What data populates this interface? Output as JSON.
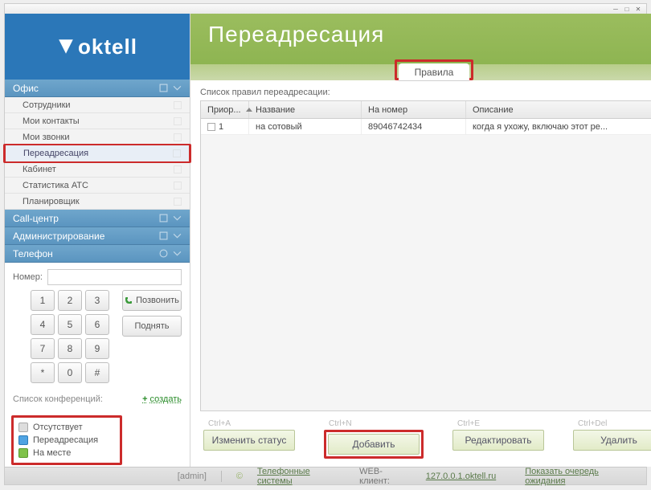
{
  "logo": "oktell",
  "sidebar": {
    "groups": [
      {
        "label": "Офис",
        "items": [
          {
            "label": "Сотрудники"
          },
          {
            "label": "Мои контакты"
          },
          {
            "label": "Мои звонки"
          },
          {
            "label": "Переадресация",
            "active": true
          },
          {
            "label": "Кабинет"
          },
          {
            "label": "Статистика АТС"
          },
          {
            "label": "Планировщик"
          }
        ]
      },
      {
        "label": "Call-центр"
      },
      {
        "label": "Администрирование"
      },
      {
        "label": "Телефон"
      }
    ]
  },
  "dial": {
    "label": "Номер:",
    "keys": [
      "1",
      "2",
      "3",
      "4",
      "5",
      "6",
      "7",
      "8",
      "9",
      "*",
      "0",
      "#"
    ],
    "call": "Позвонить",
    "pickup": "Поднять"
  },
  "conf": {
    "header": "Список конференций:",
    "create": "создать"
  },
  "status": [
    {
      "label": "Отсутствует",
      "color": "gray"
    },
    {
      "label": "Переадресация",
      "color": "blue"
    },
    {
      "label": "На месте",
      "color": "green"
    }
  ],
  "main": {
    "title": "Переадресация",
    "tab": "Правила",
    "list_label": "Список правил переадресации:",
    "columns": [
      "Приор...",
      "Название",
      "На номер",
      "Описание"
    ],
    "rows": [
      {
        "priority": "1",
        "name": "на сотовый",
        "number": "89046742434",
        "desc": "когда я ухожу, включаю этот ре..."
      }
    ],
    "actions": [
      {
        "shortcut": "Ctrl+A",
        "label": "Изменить статус"
      },
      {
        "shortcut": "Ctrl+N",
        "label": "Добавить",
        "highlight": true
      },
      {
        "shortcut": "Ctrl+E",
        "label": "Редактировать"
      },
      {
        "shortcut": "Ctrl+Del",
        "label": "Удалить"
      }
    ]
  },
  "footer": {
    "user": "[admin]",
    "phone_systems": "Телефонные системы",
    "web_label": "WEB-клиент:",
    "web_url": "127.0.0.1.oktell.ru",
    "queue": "Показать очередь ожидания"
  }
}
